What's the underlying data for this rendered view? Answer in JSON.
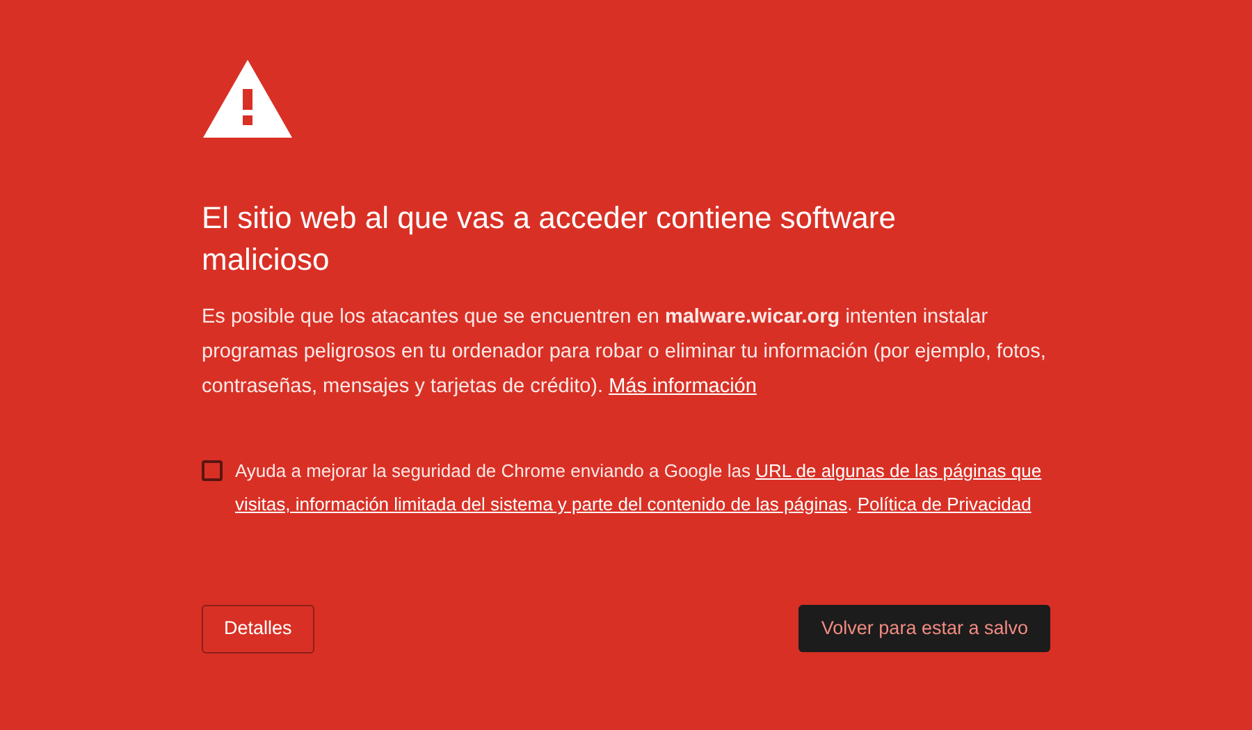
{
  "title": "El sitio web al que vas a acceder contiene software malicioso",
  "body": {
    "text": "Es posible que los atacantes que se encuentren en **malware.wicar.org** intenten instalar programas peligrosos en tu ordenador para robar o eliminar tu información (por ejemplo, fotos, contraseñas, mensajes y tarjetas de crédito).",
    "link": "Más información"
  },
  "report": {
    "checked": false,
    "segments": [
      {
        "kind": "text",
        "text": "Ayuda a mejorar la seguridad de Chrome enviando a Google las "
      },
      {
        "kind": "link",
        "text": "URL de algunas de las páginas que"
      },
      {
        "kind": "break"
      },
      {
        "kind": "link",
        "text": "visitas, información limitada del sistema y parte del contenido de las páginas"
      },
      {
        "kind": "text",
        "text": ". "
      },
      {
        "kind": "link",
        "text": "Política de Privacidad"
      }
    ]
  },
  "buttons": [
    {
      "label": "Detalles",
      "kind": "secondary"
    },
    {
      "label": "Volver para estar a salvo",
      "kind": "primary"
    }
  ]
}
